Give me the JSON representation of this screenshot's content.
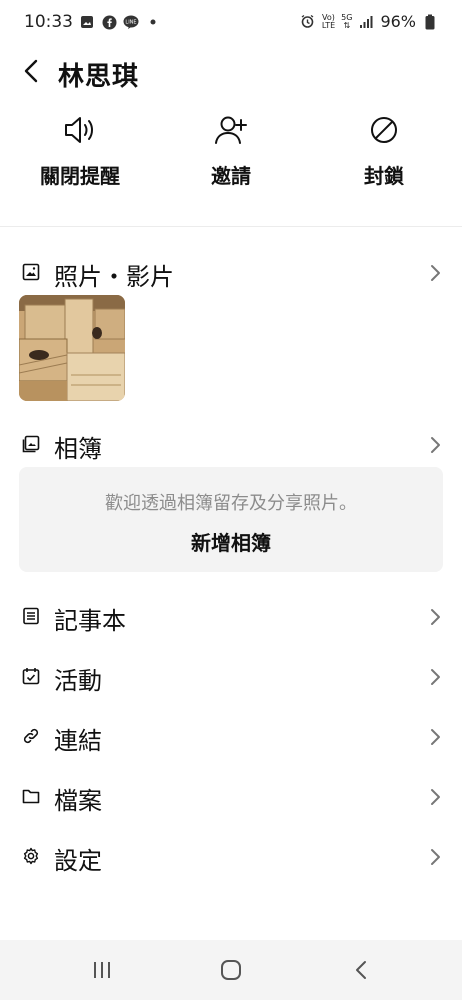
{
  "status_bar": {
    "time": "10:33",
    "battery": "96%",
    "network_top": "Vo)",
    "network_bottom": "LTE",
    "signal_label": "5G"
  },
  "header": {
    "title": "林思琪"
  },
  "actions": {
    "mute_label": "關閉提醒",
    "invite_label": "邀請",
    "block_label": "封鎖"
  },
  "sections": {
    "photos_label": "照片・影片",
    "albums_label": "相簿",
    "album_empty_text": "歡迎透過相簿留存及分享照片。",
    "album_create_label": "新增相簿",
    "notes_label": "記事本",
    "events_label": "活動",
    "links_label": "連結",
    "files_label": "檔案",
    "settings_label": "設定"
  }
}
